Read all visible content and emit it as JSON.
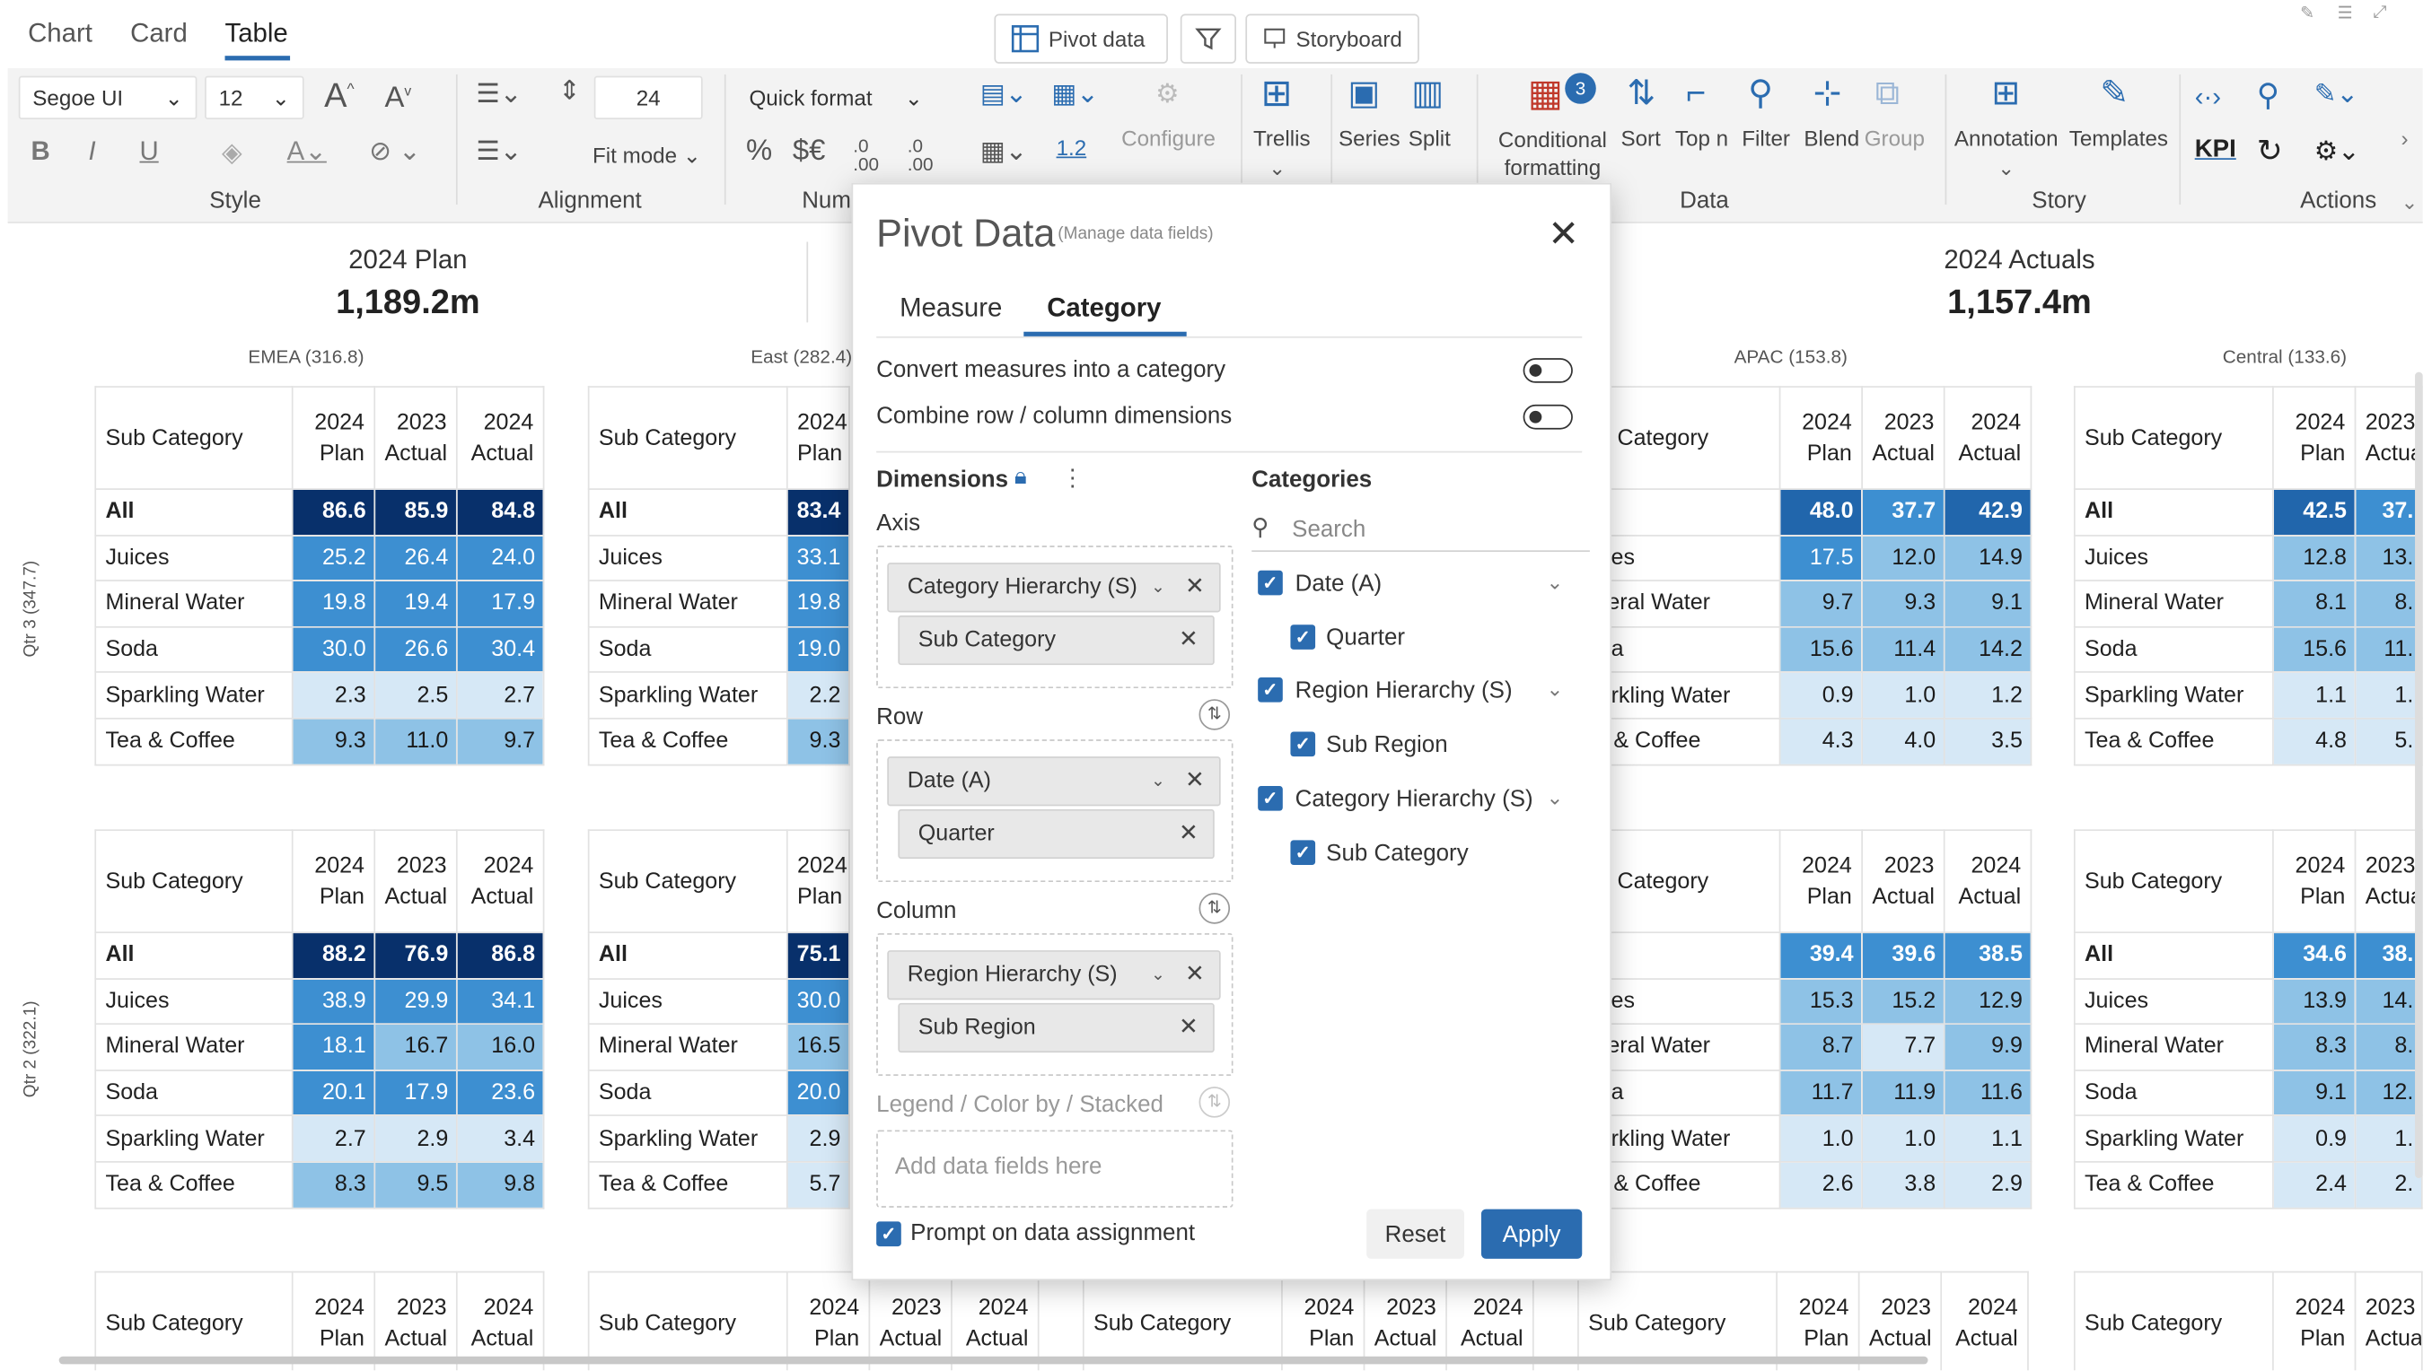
{
  "view_tabs": [
    "Chart",
    "Card",
    "Table"
  ],
  "toolbar": {
    "pivot_data": "Pivot data",
    "storyboard": "Storyboard"
  },
  "ribbon": {
    "font_family": "Segoe UI",
    "font_size": "12",
    "line_height": "24",
    "fit_mode": "Fit mode",
    "quick_format": "Quick format",
    "num_1_2": "1.2",
    "configure": "Configure",
    "trellis": "Trellis",
    "series": "Series",
    "split": "Split",
    "conditional_formatting": "Conditional formatting",
    "cf_badge": "3",
    "sort": "Sort",
    "top_n": "Top n",
    "filter": "Filter",
    "blend": "Blend",
    "group": "Group",
    "annotation": "Annotation",
    "templates": "Templates",
    "kpi": "KPI",
    "groups": {
      "style": "Style",
      "alignment": "Alignment",
      "number": "Num",
      "data": "Data",
      "story": "Story",
      "actions": "Actions"
    }
  },
  "kpis": [
    {
      "title": "2024 Plan",
      "value": "1,189.2m"
    },
    {
      "title": "2024 Actuals",
      "value": "1,157.4m"
    }
  ],
  "regions": [
    "EMEA (316.8)",
    "East (282.4)",
    "APAC (153.8)",
    "Central (133.6)"
  ],
  "row_groups": [
    "Qtr 3 (347.7)",
    "Qtr 2 (322.1)"
  ],
  "table_header": {
    "sub_category": "Sub Category",
    "col1": [
      "2024",
      "Plan"
    ],
    "col2": [
      "2023",
      "Actual"
    ],
    "col3": [
      "2024",
      "Actual"
    ]
  },
  "tables": {
    "q3_emea": [
      [
        "All",
        "86.6",
        "85.9",
        "84.8"
      ],
      [
        "Juices",
        "25.2",
        "26.4",
        "24.0"
      ],
      [
        "Mineral Water",
        "19.8",
        "19.4",
        "17.9"
      ],
      [
        "Soda",
        "30.0",
        "26.6",
        "30.4"
      ],
      [
        "Sparkling Water",
        "2.3",
        "2.5",
        "2.7"
      ],
      [
        "Tea & Coffee",
        "9.3",
        "11.0",
        "9.7"
      ]
    ],
    "q3_east": [
      [
        "All",
        "83.4"
      ],
      [
        "Juices",
        "33.1"
      ],
      [
        "Mineral Water",
        "19.8"
      ],
      [
        "Soda",
        "19.0"
      ],
      [
        "Sparkling Water",
        "2.2"
      ],
      [
        "Tea & Coffee",
        "9.3"
      ]
    ],
    "q3_apac": [
      [
        "All",
        "48.0",
        "37.7",
        "42.9"
      ],
      [
        "Juices",
        "17.5",
        "12.0",
        "14.9"
      ],
      [
        "Mineral Water",
        "9.7",
        "9.3",
        "9.1"
      ],
      [
        "Soda",
        "15.6",
        "11.4",
        "14.2"
      ],
      [
        "Sparkling Water",
        "0.9",
        "1.0",
        "1.2"
      ],
      [
        "Tea & Coffee",
        "4.3",
        "4.0",
        "3.5"
      ]
    ],
    "q3_central": [
      [
        "All",
        "42.5",
        "37."
      ],
      [
        "Juices",
        "12.8",
        "13."
      ],
      [
        "Mineral Water",
        "8.1",
        "8."
      ],
      [
        "Soda",
        "15.6",
        "11."
      ],
      [
        "Sparkling Water",
        "1.1",
        "1."
      ],
      [
        "Tea & Coffee",
        "4.8",
        "5."
      ]
    ],
    "q2_emea": [
      [
        "All",
        "88.2",
        "76.9",
        "86.8"
      ],
      [
        "Juices",
        "38.9",
        "29.9",
        "34.1"
      ],
      [
        "Mineral Water",
        "18.1",
        "16.7",
        "16.0"
      ],
      [
        "Soda",
        "20.1",
        "17.9",
        "23.6"
      ],
      [
        "Sparkling Water",
        "2.7",
        "2.9",
        "3.4"
      ],
      [
        "Tea & Coffee",
        "8.3",
        "9.5",
        "9.8"
      ]
    ],
    "q2_east": [
      [
        "All",
        "75.1"
      ],
      [
        "Juices",
        "30.0"
      ],
      [
        "Mineral Water",
        "16.5"
      ],
      [
        "Soda",
        "20.0"
      ],
      [
        "Sparkling Water",
        "2.9"
      ],
      [
        "Tea & Coffee",
        "5.7"
      ]
    ],
    "q2_apac": [
      [
        "All",
        "39.4",
        "39.6",
        "38.5"
      ],
      [
        "Juices",
        "15.3",
        "15.2",
        "12.9"
      ],
      [
        "Mineral Water",
        "8.7",
        "7.7",
        "9.9"
      ],
      [
        "Soda",
        "11.7",
        "11.9",
        "11.6"
      ],
      [
        "Sparkling Water",
        "1.0",
        "1.0",
        "1.1"
      ],
      [
        "Tea & Coffee",
        "2.6",
        "3.8",
        "2.9"
      ]
    ],
    "q2_central": [
      [
        "All",
        "34.6",
        "38."
      ],
      [
        "Juices",
        "13.9",
        "14."
      ],
      [
        "Mineral Water",
        "8.3",
        "8."
      ],
      [
        "Soda",
        "9.1",
        "12."
      ],
      [
        "Sparkling Water",
        "0.9",
        "1."
      ],
      [
        "Tea & Coffee",
        "2.4",
        "2."
      ]
    ]
  },
  "modal": {
    "title": "Pivot Data",
    "subtitle": "(Manage data fields)",
    "tabs": [
      "Measure",
      "Category"
    ],
    "active_tab": "Category",
    "convert_label": "Convert measures into a category",
    "combine_label": "Combine row / column dimensions",
    "dimensions_label": "Dimensions",
    "axis_label": "Axis",
    "axis_chips": [
      "Category Hierarchy (S)",
      "Sub Category"
    ],
    "row_label": "Row",
    "row_chips": [
      "Date (A)",
      "Quarter"
    ],
    "column_label": "Column",
    "column_chips": [
      "Region Hierarchy (S)",
      "Sub Region"
    ],
    "legend_label": "Legend / Color by / Stacked",
    "add_placeholder": "Add data fields here",
    "prompt_label": "Prompt on data assignment",
    "categories_label": "Categories",
    "search_placeholder": "Search",
    "category_tree": [
      {
        "label": "Date (A)",
        "child": "Quarter"
      },
      {
        "label": "Region Hierarchy (S)",
        "child": "Sub Region"
      },
      {
        "label": "Category Hierarchy (S)",
        "child": "Sub Category"
      }
    ],
    "reset_label": "Reset",
    "apply_label": "Apply"
  },
  "colors": {
    "accent": "#2b6cb0",
    "heat_darkest": "#08306b",
    "heat_dark": "#2166ac",
    "heat_mid": "#3d8fd1",
    "heat_light": "#8ec2e6",
    "heat_pale": "#d6e8f6"
  }
}
